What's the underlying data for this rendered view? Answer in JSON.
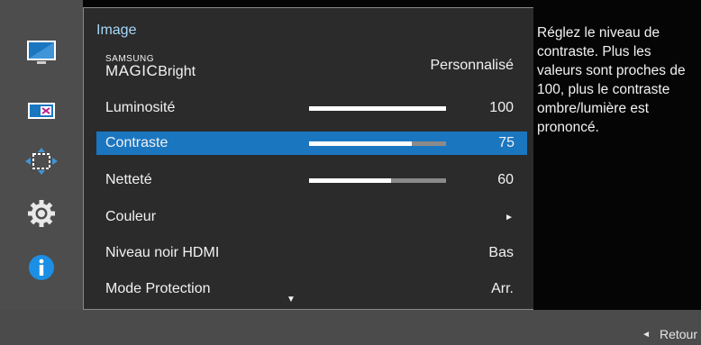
{
  "menu": {
    "title": "Image",
    "magic_top": "SAMSUNG",
    "magic_bottom": "MAGIC",
    "magic_suffix": "Bright",
    "items": [
      {
        "label": "",
        "value": "Personnalisé"
      },
      {
        "label": "Luminosité",
        "value": "100",
        "level": 100
      },
      {
        "label": "Contraste",
        "value": "75",
        "level": 75
      },
      {
        "label": "Netteté",
        "value": "60",
        "level": 60
      },
      {
        "label": "Couleur",
        "value": "►"
      },
      {
        "label": "Niveau noir HDMI",
        "value": "Bas"
      },
      {
        "label": "Mode Protection",
        "value": "Arr."
      }
    ],
    "more_indicator": "▼"
  },
  "description": {
    "text": "Réglez le niveau de contraste. Plus les valeurs sont proches de 100, plus le contraste ombre/lumière est prononcé."
  },
  "footer": {
    "back_arrow": "◄",
    "back_label": "Retour"
  },
  "sidebar": {
    "icons": [
      "monitor-icon",
      "picture-size-icon",
      "position-icon",
      "gear-icon",
      "info-icon"
    ]
  },
  "colors": {
    "selection": "#1b76c0",
    "title": "#a8d8f8",
    "info": "#1b8fe6"
  }
}
